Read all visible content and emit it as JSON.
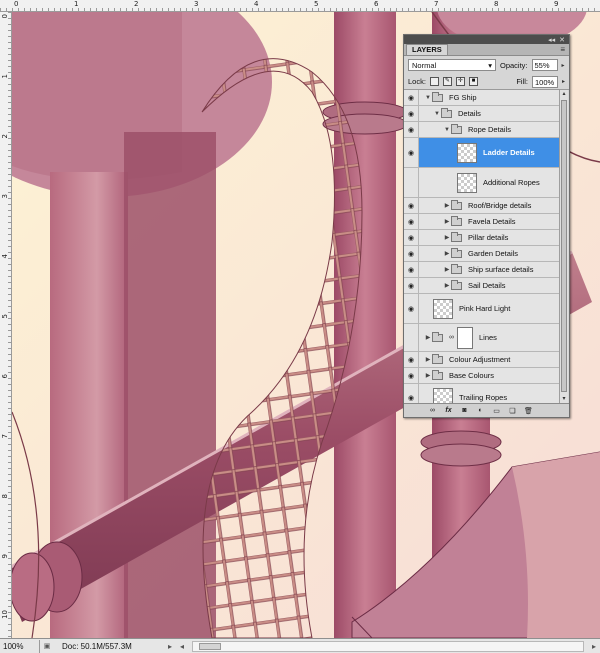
{
  "rulers": {
    "top": [
      "0",
      "1",
      "2",
      "3",
      "4",
      "5",
      "6",
      "7",
      "8",
      "9"
    ],
    "left": [
      "0",
      "1",
      "2",
      "3",
      "4",
      "5",
      "6",
      "7",
      "8",
      "9",
      "10"
    ]
  },
  "status": {
    "zoom": "100%",
    "doc": "Doc: 50.1M/557.3M"
  },
  "layers_panel": {
    "tab_label": "LAYERS",
    "blend_mode": "Normal",
    "opacity_label": "Opacity:",
    "opacity_value": "55%",
    "lock_label": "Lock:",
    "fill_label": "Fill:",
    "fill_value": "100%",
    "layers": [
      {
        "name": "FG Ship"
      },
      {
        "name": "Details"
      },
      {
        "name": "Rope Details"
      },
      {
        "name": "Ladder Details"
      },
      {
        "name": "Additional Ropes"
      },
      {
        "name": "Roof/Bridge details"
      },
      {
        "name": "Favela Details"
      },
      {
        "name": "Pillar details"
      },
      {
        "name": "Garden Details"
      },
      {
        "name": "Ship surface details"
      },
      {
        "name": "Sail Details"
      },
      {
        "name": "Pink Hard Light"
      },
      {
        "name": "Lines"
      },
      {
        "name": "Colour Adjustment"
      },
      {
        "name": "Base Colours"
      },
      {
        "name": "Trailing Ropes"
      }
    ]
  }
}
